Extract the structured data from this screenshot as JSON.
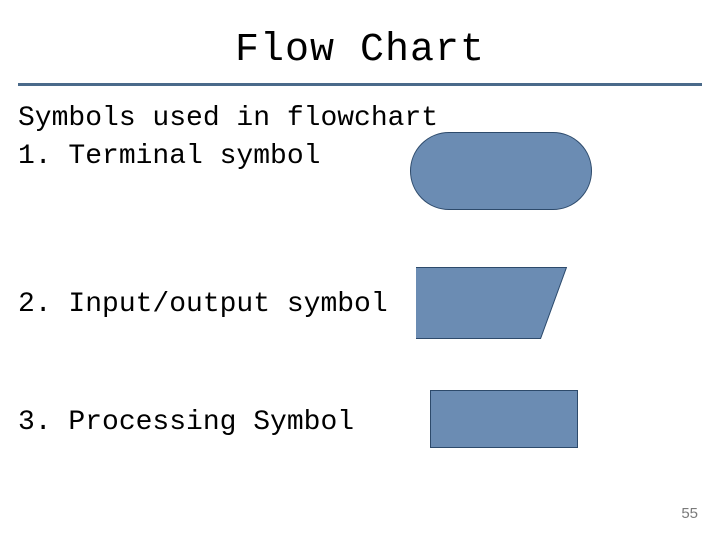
{
  "title": "Flow Chart",
  "intro": "Symbols used in flowchart",
  "items": [
    {
      "label": "1. Terminal symbol",
      "shape_name": "terminal-symbol"
    },
    {
      "label": "2. Input/output symbol",
      "shape_name": "io-symbol"
    },
    {
      "label": "3. Processing Symbol",
      "shape_name": "process-symbol"
    }
  ],
  "page_number": "55",
  "colors": {
    "shape_fill": "#6b8cb3",
    "shape_border": "#2d4a6b",
    "rule": "#4a6a8a"
  }
}
